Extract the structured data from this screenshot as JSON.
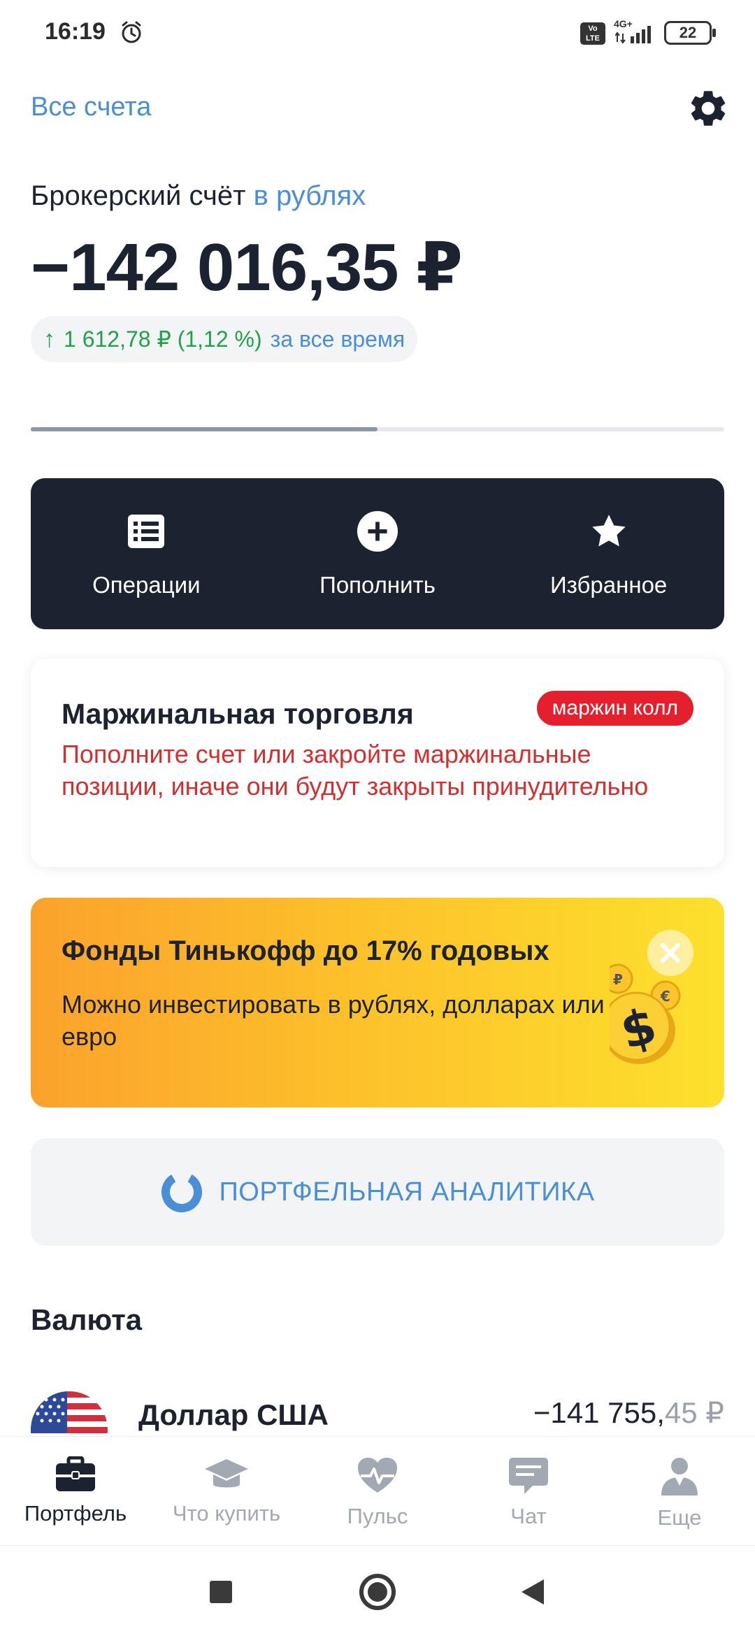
{
  "status_bar": {
    "time": "16:19",
    "network": "4G+",
    "volte": "Vo LTE",
    "battery": "22"
  },
  "header": {
    "all_accounts": "Все счета",
    "settings_icon": "gear-icon"
  },
  "account": {
    "name_prefix": "Брокерский счёт",
    "name_currency": "в рублях",
    "balance": "−142 016,35 ₽",
    "profit": "1 612,78 ₽ (1,12 %)",
    "profit_period": "за все время",
    "profit_color": "#23a04b",
    "carousel_progress": 0.5
  },
  "actions": [
    {
      "label": "Операции",
      "icon": "list-icon"
    },
    {
      "label": "Пополнить",
      "icon": "plus-circle-icon"
    },
    {
      "label": "Избранное",
      "icon": "star-icon"
    }
  ],
  "margin": {
    "title": "Маржинальная торговля",
    "badge": "маржин колл",
    "text": "Пополните счет или закройте маржинальные позиции, иначе они будут закрыты принудительно",
    "badge_color": "#e5202e"
  },
  "promo": {
    "title": "Фонды Тинькофф до 17% годовых",
    "text": "Можно инвестировать в рублях, долларах или евро",
    "close_icon": "close-icon"
  },
  "analytics": {
    "label": "ПОРТФЕЛЬНАЯ АНАЛИТИКА"
  },
  "currency_section": {
    "title": "Валюта",
    "items": [
      {
        "name": "Доллар США",
        "amount_main": "−141 755,",
        "amount_dim": "45 ₽",
        "flag": "us-flag-icon"
      }
    ]
  },
  "bottom_nav": [
    {
      "label": "Портфель",
      "icon": "briefcase-icon",
      "active": true
    },
    {
      "label": "Что купить",
      "icon": "graduation-cap-icon",
      "active": false
    },
    {
      "label": "Пульс",
      "icon": "pulse-icon",
      "active": false
    },
    {
      "label": "Чат",
      "icon": "chat-icon",
      "active": false
    },
    {
      "label": "Еще",
      "icon": "user-icon",
      "active": false
    }
  ],
  "colors": {
    "accent": "#4a8ed8",
    "dark": "#1c2230",
    "warning": "#d32f2f"
  }
}
